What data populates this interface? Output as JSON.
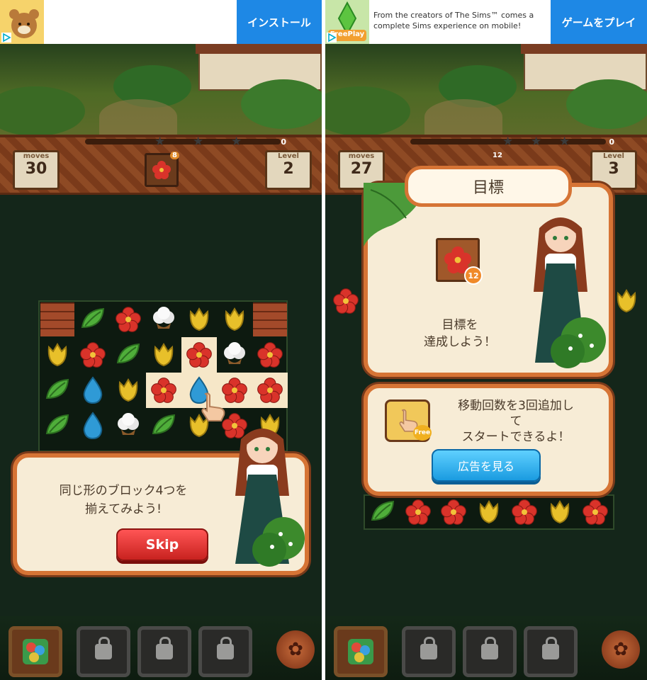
{
  "left": {
    "ad": {
      "cta": "インストール",
      "text": ""
    },
    "header": {
      "moves_label": "moves",
      "moves": "30",
      "goal_count": "8",
      "level_label": "Level",
      "level": "2",
      "score": "0"
    },
    "tutorial": {
      "line1": "同じ形のブロック4つを",
      "line2": "揃えてみよう!",
      "skip": "Skip"
    }
  },
  "right": {
    "ad": {
      "cta": "ゲームをプレイ",
      "text": "From the creators of The Sims™ comes a complete Sims experience on mobile!",
      "badge": "FreePlay"
    },
    "header": {
      "moves_label": "moves",
      "moves": "27",
      "goal_count": "12",
      "level_label": "Level",
      "level": "3",
      "score": "0"
    },
    "goal": {
      "title": "目標",
      "badge": "12",
      "line1": "目標を",
      "line2": "達成しよう！"
    },
    "offer": {
      "line1": "移動回数を3回追加し",
      "line2": "て",
      "line3": "スタートできるよ！",
      "button": "広告を見る",
      "free": "Free"
    }
  },
  "colors": {
    "accent_orange": "#d67435",
    "skip_red": "#e0302a",
    "ad_blue": "#1e88e5",
    "panel_cream": "#f7ecd6"
  },
  "board_left": [
    [
      "brick",
      "leaf",
      "flower",
      "cotton",
      "tulip",
      "tulip",
      "brick"
    ],
    [
      "tulip",
      "flower",
      "leaf",
      "tulip",
      "flower",
      "cotton",
      "flower"
    ],
    [
      "leaf",
      "drop",
      "tulip",
      "flower",
      "drop",
      "flower",
      "flower"
    ],
    [
      "leaf",
      "drop",
      "cotton",
      "leaf",
      "tulip",
      "flower",
      "tulip"
    ]
  ],
  "board_right_bottom": [
    "leaf",
    "flower",
    "flower",
    "tulip",
    "flower",
    "tulip",
    "flower"
  ],
  "board_right_top": [
    "flower",
    "tulip"
  ]
}
